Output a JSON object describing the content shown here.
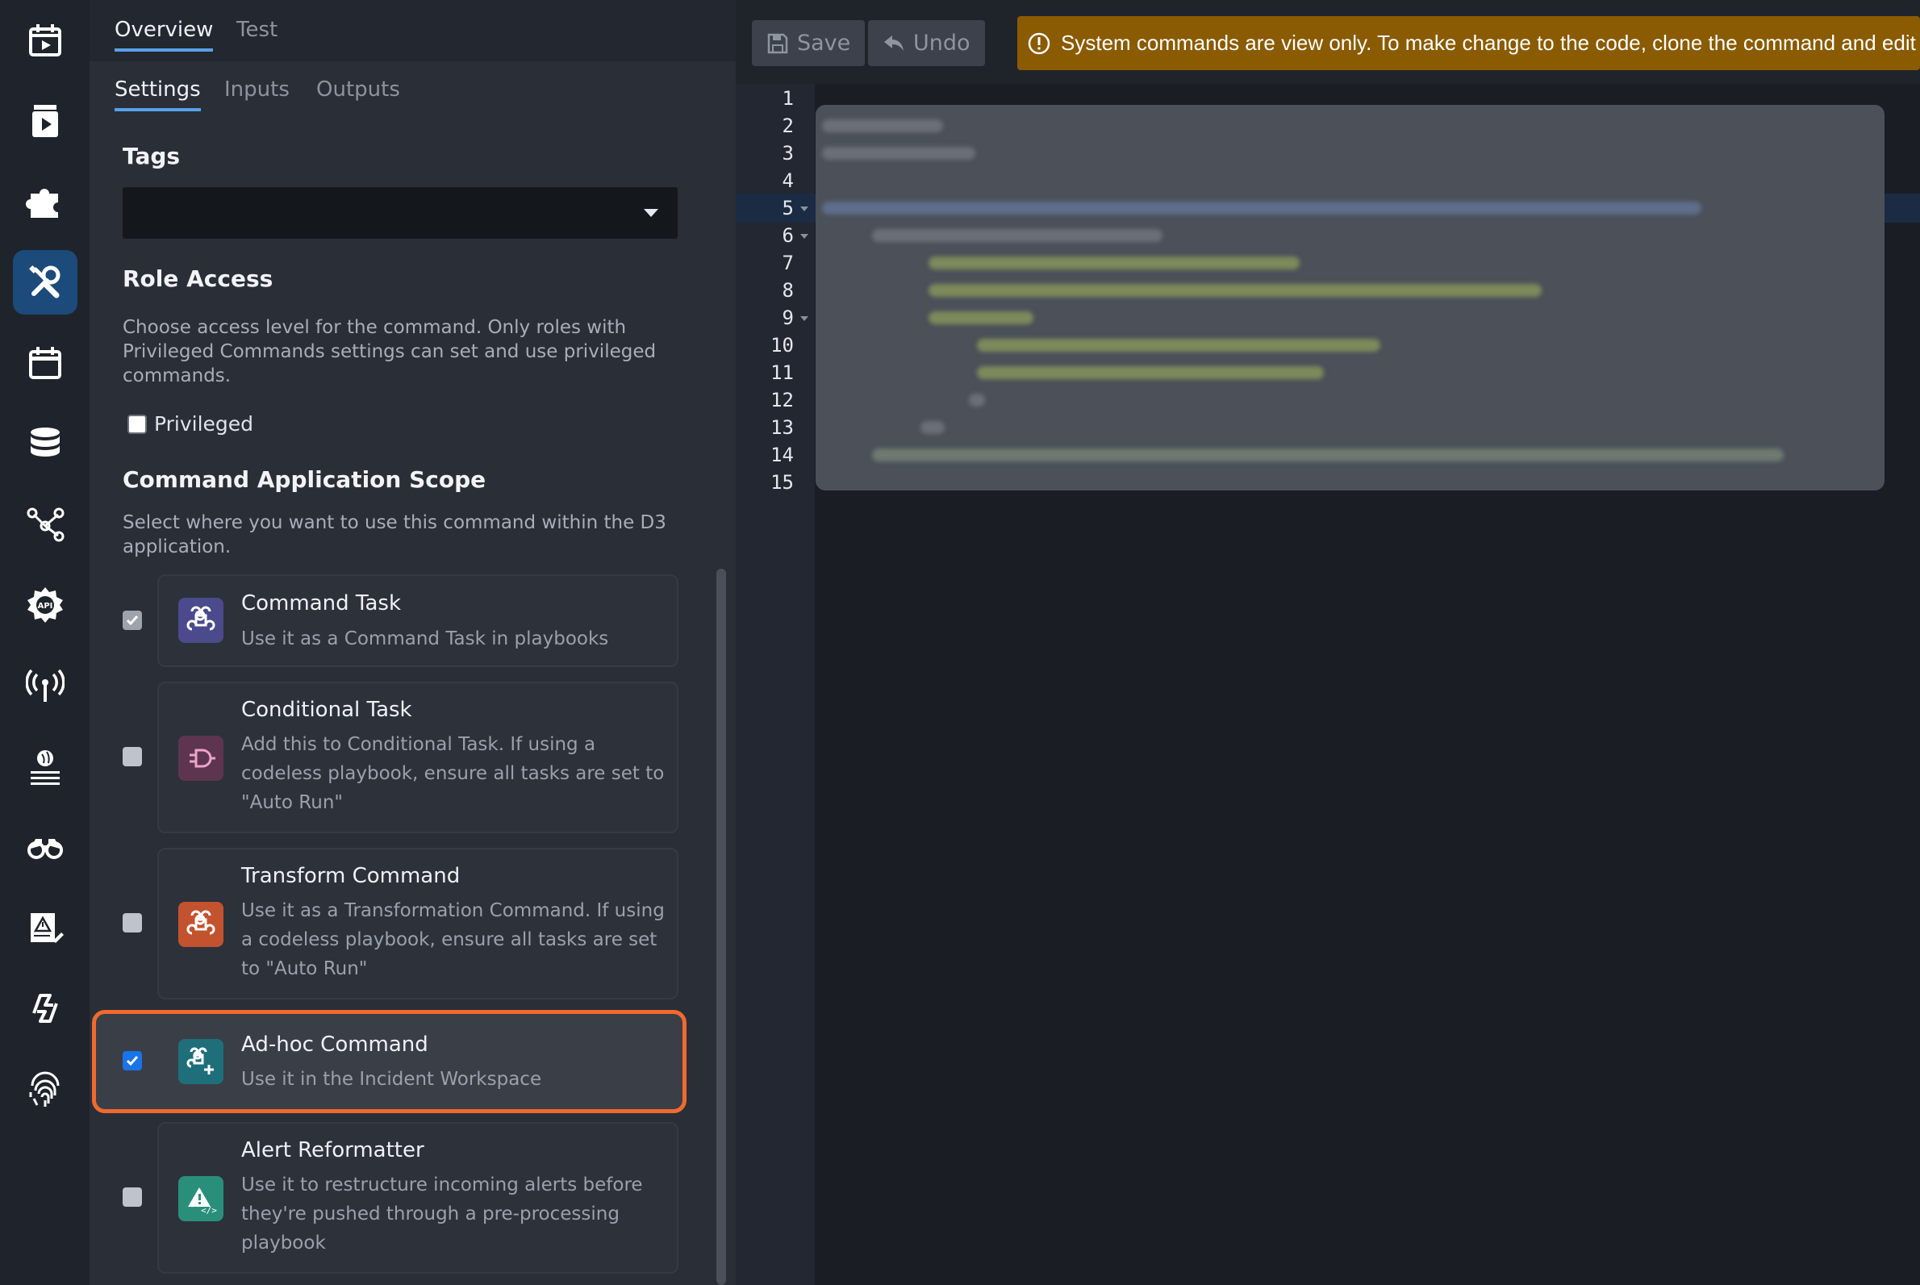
{
  "nav": {
    "items": [
      {
        "icon": "calendar-play-icon"
      },
      {
        "icon": "playbook-icon"
      },
      {
        "icon": "puzzle-icon"
      },
      {
        "icon": "tools-icon",
        "active": true
      },
      {
        "icon": "calendar-icon"
      },
      {
        "icon": "database-icon"
      },
      {
        "icon": "share-nodes-icon"
      },
      {
        "icon": "api-gear-icon"
      },
      {
        "icon": "antenna-icon"
      },
      {
        "icon": "globe-feed-icon"
      },
      {
        "icon": "binoculars-icon"
      },
      {
        "icon": "alert-edit-icon"
      },
      {
        "icon": "sync-icon"
      },
      {
        "icon": "fingerprint-icon"
      }
    ]
  },
  "panel": {
    "top_tabs": [
      "Overview",
      "Test"
    ],
    "sub_tabs": [
      "Settings",
      "Inputs",
      "Outputs"
    ],
    "tags": {
      "title": "Tags",
      "value": ""
    },
    "role_access": {
      "title": "Role Access",
      "description": "Choose access level for the command. Only roles with Privileged Commands settings can set and use privileged commands.",
      "privileged_label": "Privileged",
      "privileged_checked": false
    },
    "scope": {
      "title": "Command Application Scope",
      "description": "Select where you want to use this command within the D3 application.",
      "options": [
        {
          "title": "Command Task",
          "subtitle": "Use it as a Command Task in playbooks",
          "checked": true,
          "disabled": true,
          "color": "#4a4a8c"
        },
        {
          "title": "Conditional Task",
          "subtitle": "Add this to Conditional Task. If using a codeless playbook, ensure all tasks are set to \"Auto Run\"",
          "checked": false,
          "color": "#5e3550"
        },
        {
          "title": "Transform Command",
          "subtitle": "Use it as a Transformation Command. If using a codeless playbook, ensure all tasks are set to \"Auto Run\"",
          "checked": false,
          "color": "#c2532e"
        },
        {
          "title": "Ad-hoc Command",
          "subtitle": "Use it in the Incident Workspace",
          "checked": true,
          "color": "#1e6f7a"
        },
        {
          "title": "Alert Reformatter",
          "subtitle": "Use it to restructure incoming alerts before they're pushed through a pre-processing playbook",
          "checked": false,
          "color": "#2a8f7a"
        }
      ]
    }
  },
  "toolbar": {
    "save_label": "Save",
    "undo_label": "Undo",
    "warning": "System commands are view only. To make change to the code, clone the command and edit"
  },
  "editor": {
    "line_numbers": [
      "1",
      "2",
      "3",
      "4",
      "5",
      "6",
      "7",
      "8",
      "9",
      "10",
      "11",
      "12",
      "13",
      "14",
      "15"
    ]
  },
  "colors": {
    "accent": "#5aa0e8",
    "highlight": "#f06a2e",
    "warning": "#8a5b00",
    "active_nav": "#1c4a7a"
  }
}
